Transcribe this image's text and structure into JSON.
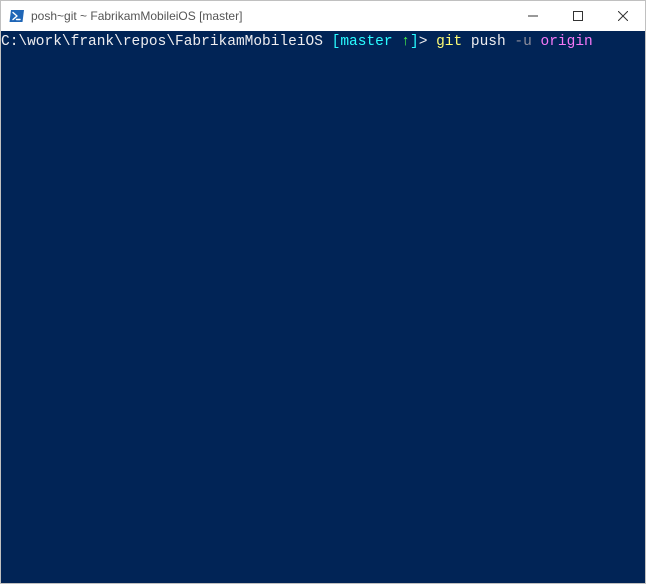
{
  "titlebar": {
    "title": "posh~git ~ FabrikamMobileiOS [master]"
  },
  "prompt": {
    "path": "C:\\work\\frank\\repos\\FabrikamMobileiOS ",
    "branch_open": "[",
    "branch_name": "master ",
    "branch_arrow": "↑",
    "branch_close": "]",
    "gt": ">"
  },
  "command": {
    "git": "git",
    "push": "push",
    "flag": "-u",
    "remote": "origin"
  }
}
